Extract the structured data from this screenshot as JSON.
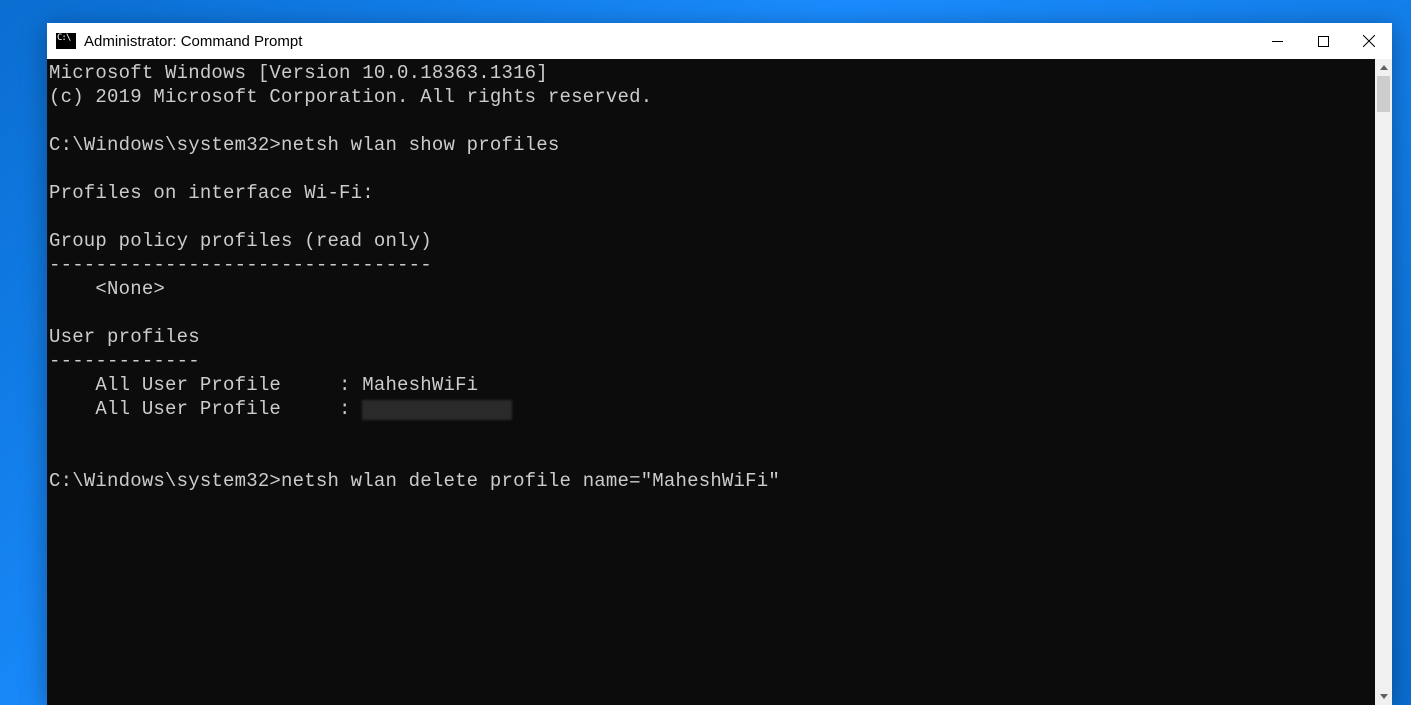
{
  "window": {
    "title": "Administrator: Command Prompt"
  },
  "terminal": {
    "header1": "Microsoft Windows [Version 10.0.18363.1316]",
    "header2": "(c) 2019 Microsoft Corporation. All rights reserved.",
    "prompt1_path": "C:\\Windows\\system32>",
    "prompt1_cmd": "netsh wlan show profiles",
    "section_interface": "Profiles on interface Wi-Fi:",
    "group_policy_header": "Group policy profiles (read only)",
    "group_policy_sep": "---------------------------------",
    "group_policy_none": "    <None>",
    "user_profiles_header": "User profiles",
    "user_profiles_sep": "-------------",
    "user_profile_row1_label": "    All User Profile     : ",
    "user_profile_row1_value": "MaheshWiFi",
    "user_profile_row2_label": "    All User Profile     : ",
    "prompt2_path": "C:\\Windows\\system32>",
    "prompt2_cmd": "netsh wlan delete profile name=\"MaheshWiFi\""
  }
}
